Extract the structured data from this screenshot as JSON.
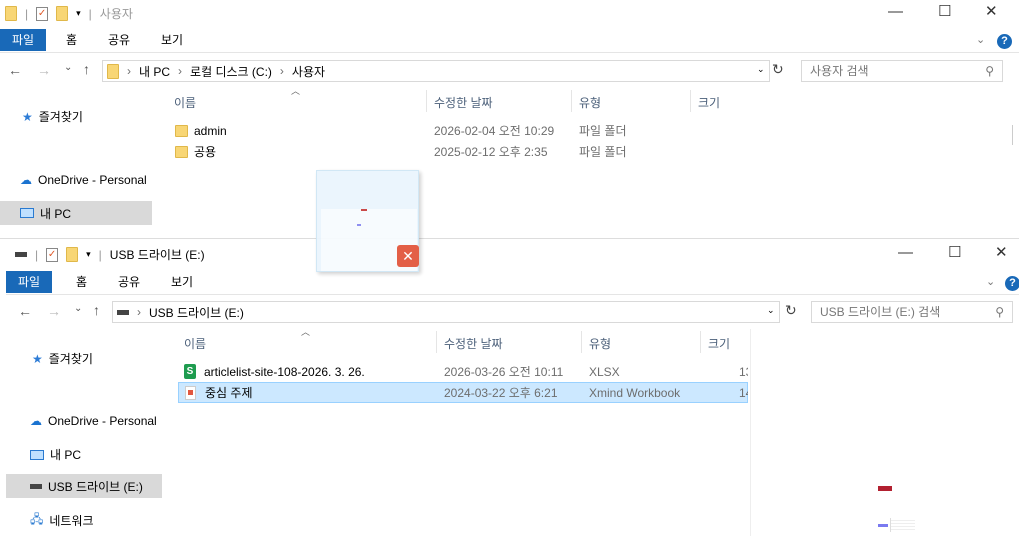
{
  "back_window": {
    "title": "사용자",
    "ribbon_tabs": [
      "파일",
      "홈",
      "공유",
      "보기"
    ],
    "breadcrumb": [
      "내 PC",
      "로컬 디스크 (C:)",
      "사용자"
    ],
    "search_placeholder": "사용자 검색",
    "columns": [
      "이름",
      "수정한 날짜",
      "유형",
      "크기"
    ],
    "sidebar": [
      "즐겨찾기",
      "OneDrive - Personal",
      "내 PC"
    ],
    "files": [
      {
        "name": "admin",
        "date": "2026-02-04 오전 10:29",
        "type": "파일 폴더"
      },
      {
        "name": "공용",
        "date": "2025-02-12 오후 2:35",
        "type": "파일 폴더"
      }
    ]
  },
  "front_window": {
    "title": "USB 드라이브 (E:)",
    "ribbon_tabs": [
      "파일",
      "홈",
      "공유",
      "보기"
    ],
    "breadcrumb": [
      "USB 드라이브 (E:)"
    ],
    "search_placeholder": "USB 드라이브 (E:) 검색",
    "columns": [
      "이름",
      "수정한 날짜",
      "유형",
      "크기"
    ],
    "sidebar": [
      "즐겨찾기",
      "OneDrive - Personal",
      "내 PC",
      "USB 드라이브 (E:)",
      "네트워크"
    ],
    "files": [
      {
        "name": "articlelist-site-108-2026. 3. 26.",
        "date": "2026-03-26 오전 10:11",
        "type": "XLSX",
        "size": "13"
      },
      {
        "name": "중심 주제",
        "date": "2024-03-22 오후 6:21",
        "type": "Xmind Workbook",
        "size": "14"
      }
    ]
  },
  "colors": {
    "accent": "#1969b8",
    "selected": "#cce8ff",
    "selected_sidebar": "#d9d9d9"
  }
}
